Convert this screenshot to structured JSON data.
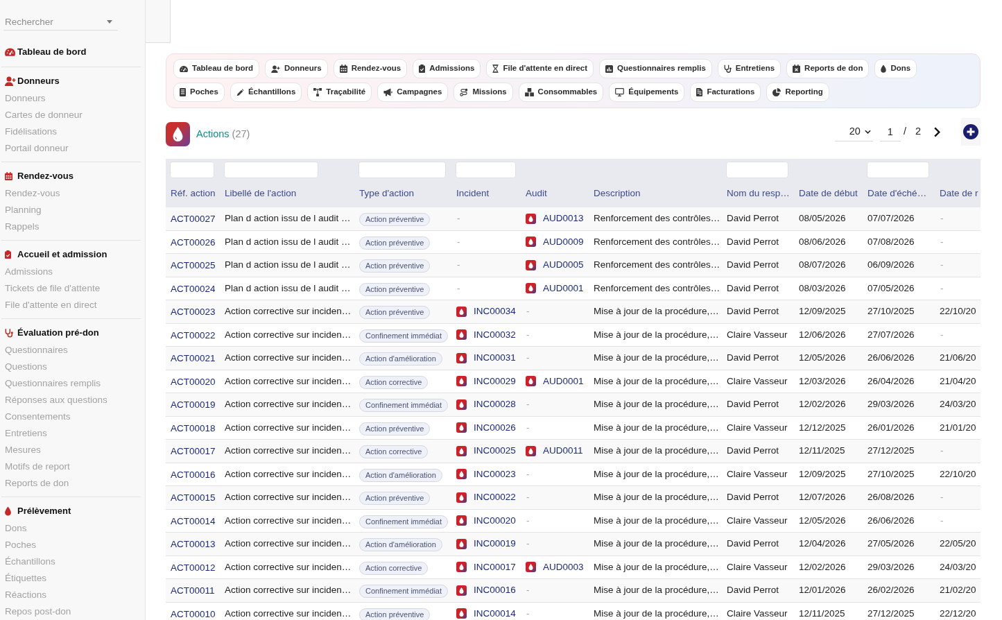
{
  "sidebar": {
    "search": {
      "placeholder": "Rechercher"
    },
    "sections": [
      {
        "title": "Tableau de bord"
      },
      {
        "title": "Donneurs",
        "items": [
          "Donneurs",
          "Cartes de donneur",
          "Fidélisations",
          "Portail donneur"
        ]
      },
      {
        "title": "Rendez-vous",
        "items": [
          "Rendez-vous",
          "Planning",
          "Rappels"
        ]
      },
      {
        "title": "Accueil et admission",
        "items": [
          "Admissions",
          "Tickets de file d'attente",
          "File d'attente en direct"
        ]
      },
      {
        "title": "Évaluation pré-don",
        "items": [
          "Questionnaires",
          "Questions",
          "Questionnaires remplis",
          "Réponses aux questions",
          "Consentements",
          "Entretiens",
          "Mesures",
          "Motifs de report",
          "Reports de don"
        ]
      },
      {
        "title": "Prélèvement",
        "items": [
          "Dons",
          "Poches",
          "Échantillons",
          "Étiquettes",
          "Réactions",
          "Repos post-don"
        ]
      }
    ]
  },
  "modules": [
    "Tableau de bord",
    "Donneurs",
    "Rendez-vous",
    "Admissions",
    "File d'attente en direct",
    "Questionnaires remplis",
    "Entretiens",
    "Reports de don",
    "Dons",
    "Poches",
    "Échantillons",
    "Traçabilité",
    "Campagnes",
    "Missions",
    "Consommables",
    "Équipements",
    "Facturations",
    "Reporting"
  ],
  "header": {
    "title": "Actions",
    "count": "(27)",
    "page_size": "20",
    "page": "1",
    "page_separator": "/",
    "page_total": "2"
  },
  "table": {
    "columns": [
      {
        "label": "Réf. action",
        "filter": true
      },
      {
        "label": "Libellé de l'action",
        "filter": true
      },
      {
        "label": "Type d'action",
        "filter": true
      },
      {
        "label": "Incident",
        "filter": true
      },
      {
        "label": "Audit",
        "filter": false
      },
      {
        "label": "Description",
        "filter": false
      },
      {
        "label": "Nom du resp…",
        "filter": true
      },
      {
        "label": "Date de début",
        "filter": false
      },
      {
        "label": "Date d'éché…",
        "filter": true
      },
      {
        "label": "Date de r",
        "filter": false
      }
    ],
    "rows": [
      {
        "ref": "ACT00027",
        "label": "Plan d action issu de l audit …",
        "type": "Action préventive",
        "incident": {
          "kind": "none",
          "text": "-"
        },
        "audit": {
          "kind": "link",
          "text": "AUD0013"
        },
        "description": "Renforcement des contrôles…",
        "owner": "David Perrot",
        "start": "08/05/2026",
        "due": "07/07/2026",
        "column_10": {
          "kind": "none",
          "text": "-"
        }
      },
      {
        "ref": "ACT00026",
        "label": "Plan d action issu de l audit …",
        "type": "Action préventive",
        "incident": {
          "kind": "none",
          "text": "-"
        },
        "audit": {
          "kind": "link",
          "text": "AUD0009"
        },
        "description": "Renforcement des contrôles…",
        "owner": "David Perrot",
        "start": "08/06/2026",
        "due": "07/08/2026",
        "column_10": {
          "kind": "none",
          "text": "-"
        }
      },
      {
        "ref": "ACT00025",
        "label": "Plan d action issu de l audit …",
        "type": "Action préventive",
        "incident": {
          "kind": "none",
          "text": "-"
        },
        "audit": {
          "kind": "link",
          "text": "AUD0005"
        },
        "description": "Renforcement des contrôles…",
        "owner": "David Perrot",
        "start": "08/07/2026",
        "due": "06/09/2026",
        "column_10": {
          "kind": "none",
          "text": "-"
        }
      },
      {
        "ref": "ACT00024",
        "label": "Plan d action issu de l audit …",
        "type": "Action préventive",
        "incident": {
          "kind": "none",
          "text": "-"
        },
        "audit": {
          "kind": "link",
          "text": "AUD0001"
        },
        "description": "Renforcement des contrôles…",
        "owner": "David Perrot",
        "start": "08/03/2026",
        "due": "07/05/2026",
        "column_10": {
          "kind": "none",
          "text": "-"
        }
      },
      {
        "ref": "ACT00023",
        "label": "Action corrective sur inciden…",
        "type": "Action préventive",
        "incident": {
          "kind": "link",
          "text": "INC00034"
        },
        "audit": {
          "kind": "none",
          "text": "-"
        },
        "description": "Mise à jour de la procédure,…",
        "owner": "David Perrot",
        "start": "12/09/2025",
        "due": "27/10/2025",
        "column_10": {
          "kind": "date",
          "text": "22/10/20"
        }
      },
      {
        "ref": "ACT00022",
        "label": "Action corrective sur inciden…",
        "type": "Confinement immédiat",
        "incident": {
          "kind": "link",
          "text": "INC00032"
        },
        "audit": {
          "kind": "none",
          "text": "-"
        },
        "description": "Mise à jour de la procédure,…",
        "owner": "Claire Vasseur",
        "start": "12/06/2026",
        "due": "27/07/2026",
        "column_10": {
          "kind": "none",
          "text": "-"
        }
      },
      {
        "ref": "ACT00021",
        "label": "Action corrective sur inciden…",
        "type": "Action d'amélioration",
        "incident": {
          "kind": "link",
          "text": "INC00031"
        },
        "audit": {
          "kind": "none",
          "text": "-"
        },
        "description": "Mise à jour de la procédure,…",
        "owner": "David Perrot",
        "start": "12/05/2026",
        "due": "26/06/2026",
        "column_10": {
          "kind": "date",
          "text": "21/06/20"
        }
      },
      {
        "ref": "ACT00020",
        "label": "Action corrective sur inciden…",
        "type": "Action corrective",
        "incident": {
          "kind": "link",
          "text": "INC00029"
        },
        "audit": {
          "kind": "link",
          "text": "AUD0001"
        },
        "description": "Mise à jour de la procédure,…",
        "owner": "Claire Vasseur",
        "start": "12/03/2026",
        "due": "26/04/2026",
        "column_10": {
          "kind": "date",
          "text": "21/04/20"
        }
      },
      {
        "ref": "ACT00019",
        "label": "Action corrective sur inciden…",
        "type": "Confinement immédiat",
        "incident": {
          "kind": "link",
          "text": "INC00028"
        },
        "audit": {
          "kind": "none",
          "text": "-"
        },
        "description": "Mise à jour de la procédure,…",
        "owner": "David Perrot",
        "start": "12/02/2026",
        "due": "29/03/2026",
        "column_10": {
          "kind": "date",
          "text": "24/03/20"
        }
      },
      {
        "ref": "ACT00018",
        "label": "Action corrective sur inciden…",
        "type": "Action préventive",
        "incident": {
          "kind": "link",
          "text": "INC00026"
        },
        "audit": {
          "kind": "none",
          "text": "-"
        },
        "description": "Mise à jour de la procédure,…",
        "owner": "Claire Vasseur",
        "start": "12/12/2025",
        "due": "26/01/2026",
        "column_10": {
          "kind": "date",
          "text": "21/01/20"
        }
      },
      {
        "ref": "ACT00017",
        "label": "Action corrective sur inciden…",
        "type": "Action corrective",
        "incident": {
          "kind": "link",
          "text": "INC00025"
        },
        "audit": {
          "kind": "link",
          "text": "AUD0011"
        },
        "description": "Mise à jour de la procédure,…",
        "owner": "David Perrot",
        "start": "12/11/2025",
        "due": "27/12/2025",
        "column_10": {
          "kind": "none",
          "text": "-"
        }
      },
      {
        "ref": "ACT00016",
        "label": "Action corrective sur inciden…",
        "type": "Action d'amélioration",
        "incident": {
          "kind": "link",
          "text": "INC00023"
        },
        "audit": {
          "kind": "none",
          "text": "-"
        },
        "description": "Mise à jour de la procédure,…",
        "owner": "Claire Vasseur",
        "start": "12/09/2025",
        "due": "27/10/2025",
        "column_10": {
          "kind": "date",
          "text": "22/10/20"
        }
      },
      {
        "ref": "ACT00015",
        "label": "Action corrective sur inciden…",
        "type": "Action préventive",
        "incident": {
          "kind": "link",
          "text": "INC00022"
        },
        "audit": {
          "kind": "none",
          "text": "-"
        },
        "description": "Mise à jour de la procédure,…",
        "owner": "David Perrot",
        "start": "12/07/2026",
        "due": "26/08/2026",
        "column_10": {
          "kind": "none",
          "text": "-"
        }
      },
      {
        "ref": "ACT00014",
        "label": "Action corrective sur inciden…",
        "type": "Confinement immédiat",
        "incident": {
          "kind": "link",
          "text": "INC00020"
        },
        "audit": {
          "kind": "none",
          "text": "-"
        },
        "description": "Mise à jour de la procédure,…",
        "owner": "Claire Vasseur",
        "start": "12/05/2026",
        "due": "26/06/2026",
        "column_10": {
          "kind": "none",
          "text": "-"
        }
      },
      {
        "ref": "ACT00013",
        "label": "Action corrective sur inciden…",
        "type": "Action d'amélioration",
        "incident": {
          "kind": "link",
          "text": "INC00019"
        },
        "audit": {
          "kind": "none",
          "text": "-"
        },
        "description": "Mise à jour de la procédure,…",
        "owner": "David Perrot",
        "start": "12/04/2026",
        "due": "27/05/2026",
        "column_10": {
          "kind": "date",
          "text": "22/05/20"
        }
      },
      {
        "ref": "ACT00012",
        "label": "Action corrective sur inciden…",
        "type": "Action corrective",
        "incident": {
          "kind": "link",
          "text": "INC00017"
        },
        "audit": {
          "kind": "link",
          "text": "AUD0003"
        },
        "description": "Mise à jour de la procédure,…",
        "owner": "Claire Vasseur",
        "start": "12/02/2026",
        "due": "29/03/2026",
        "column_10": {
          "kind": "date",
          "text": "24/03/20"
        }
      },
      {
        "ref": "ACT00011",
        "label": "Action corrective sur inciden…",
        "type": "Confinement immédiat",
        "incident": {
          "kind": "link",
          "text": "INC00016"
        },
        "audit": {
          "kind": "none",
          "text": "-"
        },
        "description": "Mise à jour de la procédure,…",
        "owner": "David Perrot",
        "start": "12/01/2026",
        "due": "26/02/2026",
        "column_10": {
          "kind": "date",
          "text": "21/02/20"
        }
      },
      {
        "ref": "ACT00010",
        "label": "Action corrective sur inciden…",
        "type": "Action préventive",
        "incident": {
          "kind": "link",
          "text": "INC00014"
        },
        "audit": {
          "kind": "none",
          "text": "-"
        },
        "description": "Mise à jour de la procédure,…",
        "owner": "Claire Vasseur",
        "start": "12/11/2025",
        "due": "27/12/2025",
        "column_10": {
          "kind": "date",
          "text": "22/12/20"
        }
      }
    ]
  }
}
